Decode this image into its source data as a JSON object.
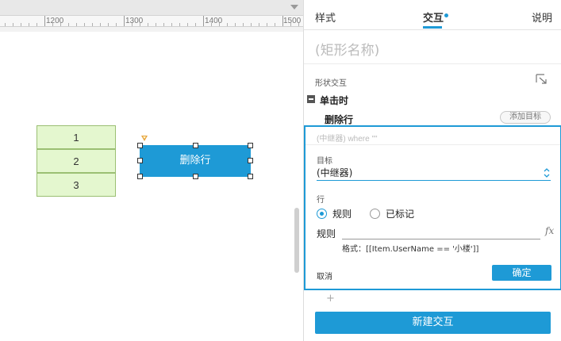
{
  "canvas": {
    "ruler_labels": [
      "1200",
      "1300",
      "1400",
      "1500"
    ],
    "repeater_rows": [
      "1",
      "2",
      "3"
    ],
    "shape_label": "删除行"
  },
  "panel": {
    "tabs": {
      "style": "样式",
      "interaction": "交互",
      "notes": "说明"
    },
    "shape_name": "(矩形名称)",
    "section_title": "形状交互",
    "event_title": "单击时",
    "action_label": "删除行",
    "add_target_label": "添加目标",
    "editor": {
      "summary": "(中继器) where \"\"",
      "target_label": "目标",
      "target_value": "(中继器)",
      "row_label": "行",
      "radio_rule_label": "规则",
      "radio_marked_label": "已标记",
      "selected_radio": "规则",
      "rule_label": "规则",
      "rule_value": "",
      "fx_label": "fx",
      "format_hint": "格式：[[Item.UserName == '小楼']]",
      "cancel_label": "取消",
      "confirm_label": "确定"
    },
    "add_plus": "+",
    "new_interaction_label": "新建交互"
  },
  "colors": {
    "accent": "#1e9ad6",
    "repeater_fill": "#e4f7cf",
    "repeater_border": "#9bbf73"
  }
}
